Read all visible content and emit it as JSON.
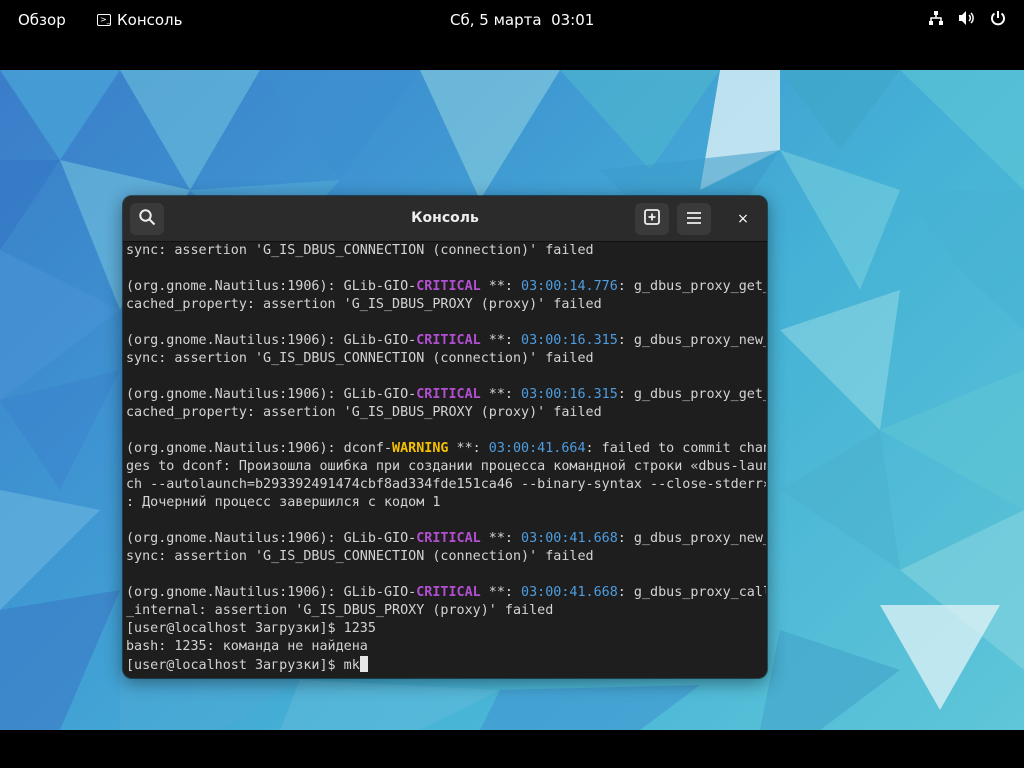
{
  "topbar": {
    "overview_label": "Обзор",
    "app_label": "Консоль",
    "clock": "Сб, 5 марта  03:01",
    "icons": [
      "network-icon",
      "volume-icon",
      "power-icon"
    ]
  },
  "window": {
    "title": "Консоль",
    "close_glyph": "×"
  },
  "terminal": {
    "lines": [
      [
        {
          "t": "sync: assertion 'G_IS_DBUS_CONNECTION (connection)' failed"
        }
      ],
      [],
      [
        {
          "t": "(org.gnome.Nautilus:1906): GLib-GIO-"
        },
        {
          "t": "CRITICAL",
          "c": "crit"
        },
        {
          "t": " **: "
        },
        {
          "t": "03:00:14.776",
          "c": "ts"
        },
        {
          "t": ": g_dbus_proxy_get_"
        }
      ],
      [
        {
          "t": "cached_property: assertion 'G_IS_DBUS_PROXY (proxy)' failed"
        }
      ],
      [],
      [
        {
          "t": "(org.gnome.Nautilus:1906): GLib-GIO-"
        },
        {
          "t": "CRITICAL",
          "c": "crit"
        },
        {
          "t": " **: "
        },
        {
          "t": "03:00:16.315",
          "c": "ts"
        },
        {
          "t": ": g_dbus_proxy_new_"
        }
      ],
      [
        {
          "t": "sync: assertion 'G_IS_DBUS_CONNECTION (connection)' failed"
        }
      ],
      [],
      [
        {
          "t": "(org.gnome.Nautilus:1906): GLib-GIO-"
        },
        {
          "t": "CRITICAL",
          "c": "crit"
        },
        {
          "t": " **: "
        },
        {
          "t": "03:00:16.315",
          "c": "ts"
        },
        {
          "t": ": g_dbus_proxy_get_"
        }
      ],
      [
        {
          "t": "cached_property: assertion 'G_IS_DBUS_PROXY (proxy)' failed"
        }
      ],
      [],
      [
        {
          "t": "(org.gnome.Nautilus:1906): dconf-"
        },
        {
          "t": "WARNING",
          "c": "warn"
        },
        {
          "t": " **: "
        },
        {
          "t": "03:00:41.664",
          "c": "ts"
        },
        {
          "t": ": failed to commit chan"
        }
      ],
      [
        {
          "t": "ges to dconf: Произошла ошибка при создании процесса командной строки «dbus-laun"
        }
      ],
      [
        {
          "t": "ch --autolaunch=b293392491474cbf8ad334fde151ca46 --binary-syntax --close-stderr»"
        }
      ],
      [
        {
          "t": ": Дочерний процесс завершился с кодом 1"
        }
      ],
      [],
      [
        {
          "t": "(org.gnome.Nautilus:1906): GLib-GIO-"
        },
        {
          "t": "CRITICAL",
          "c": "crit"
        },
        {
          "t": " **: "
        },
        {
          "t": "03:00:41.668",
          "c": "ts"
        },
        {
          "t": ": g_dbus_proxy_new_"
        }
      ],
      [
        {
          "t": "sync: assertion 'G_IS_DBUS_CONNECTION (connection)' failed"
        }
      ],
      [],
      [
        {
          "t": "(org.gnome.Nautilus:1906): GLib-GIO-"
        },
        {
          "t": "CRITICAL",
          "c": "crit"
        },
        {
          "t": " **: "
        },
        {
          "t": "03:00:41.668",
          "c": "ts"
        },
        {
          "t": ": g_dbus_proxy_call"
        }
      ],
      [
        {
          "t": "_internal: assertion 'G_IS_DBUS_PROXY (proxy)' failed"
        }
      ],
      [
        {
          "t": "[user@localhost Загрузки]$ 1235"
        }
      ],
      [
        {
          "t": "bash: 1235: команда не найдена"
        }
      ],
      [
        {
          "t": "[user@localhost Загрузки]$ mk"
        }
      ]
    ],
    "cursor_after_last_line": true
  },
  "colors": {
    "critical": "#b24fd0",
    "warning": "#f5c000",
    "timestamp": "#4d9de0",
    "terminal_bg": "#1e1e1e",
    "headerbar_bg": "#2b2b2b"
  }
}
